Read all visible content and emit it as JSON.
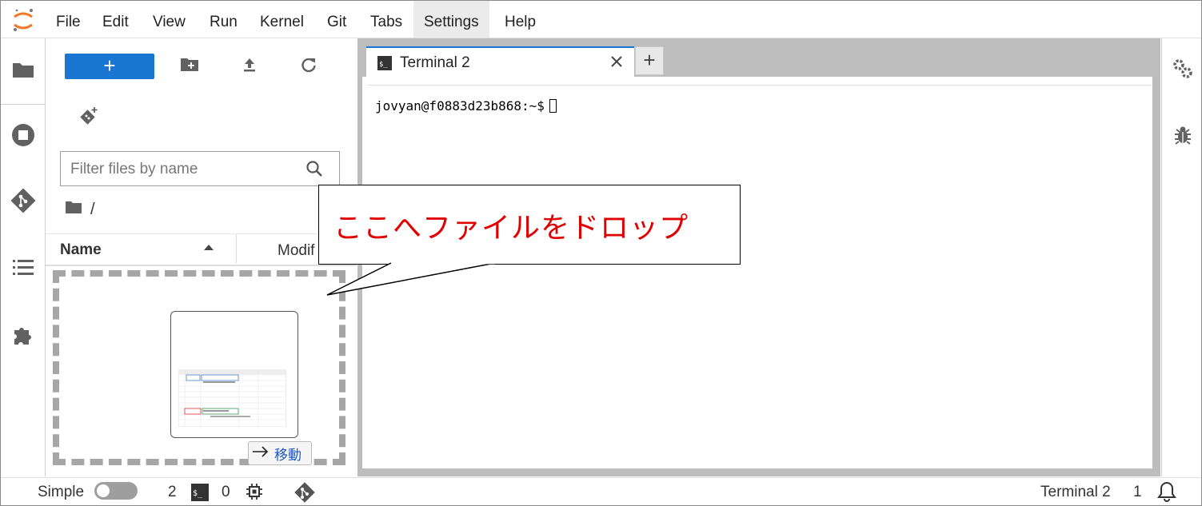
{
  "menu": {
    "items": [
      "File",
      "Edit",
      "View",
      "Run",
      "Kernel",
      "Git",
      "Tabs",
      "Settings",
      "Help"
    ],
    "active": "Settings"
  },
  "filebrowser": {
    "new_label": "+",
    "filter_placeholder": "Filter files by name",
    "breadcrumb": "/",
    "columns": {
      "name": "Name",
      "modified": "Modif"
    },
    "move_tooltip": "移動"
  },
  "main": {
    "tab_title": "Terminal 2",
    "add_tab": "+",
    "terminal_prompt": "jovyan@f0883d23b868:~$"
  },
  "callout": {
    "text": "ここへファイルをドロップ"
  },
  "status": {
    "mode_label": "Simple",
    "terminals_count": "2",
    "kernels_count": "0",
    "active_name": "Terminal 2",
    "notifications_count": "1"
  },
  "colors": {
    "accent": "#1976d2",
    "callout_text": "#e00000"
  },
  "icons": [
    "jupyter-logo-icon",
    "folder-icon",
    "running-icon",
    "git-icon",
    "toc-icon",
    "extension-icon",
    "new-folder-icon",
    "upload-icon",
    "refresh-icon",
    "git-clone-icon",
    "search-icon",
    "terminal-icon",
    "close-icon",
    "property-inspector-icon",
    "debugger-icon",
    "cpu-icon",
    "bell-icon"
  ]
}
